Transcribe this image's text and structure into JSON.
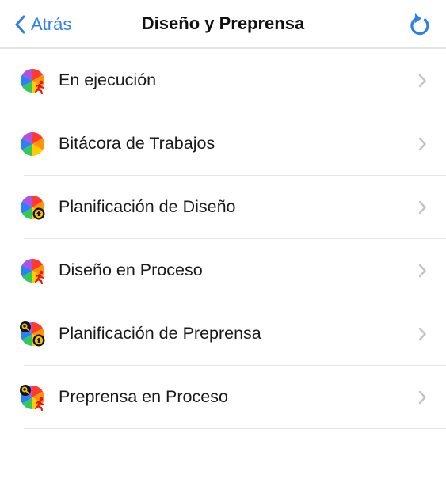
{
  "nav": {
    "back_label": "Atrás",
    "title": "Diseño y Preprensa"
  },
  "items": [
    {
      "label": "En ejecución",
      "icon": "color-wheel-runner-icon"
    },
    {
      "label": "Bitácora de Trabajos",
      "icon": "color-wheel-icon"
    },
    {
      "label": "Planificación de Diseño",
      "icon": "color-wheel-upload-icon"
    },
    {
      "label": "Diseño en Proceso",
      "icon": "color-wheel-runner-icon"
    },
    {
      "label": "Planificación de Preprensa",
      "icon": "color-wheel-key-upload-icon"
    },
    {
      "label": "Preprensa en Proceso",
      "icon": "color-wheel-key-runner-icon"
    }
  ],
  "colors": {
    "accent": "#2f7fe6",
    "separator": "#e4e4e7",
    "chevron": "#c2c2c7"
  }
}
